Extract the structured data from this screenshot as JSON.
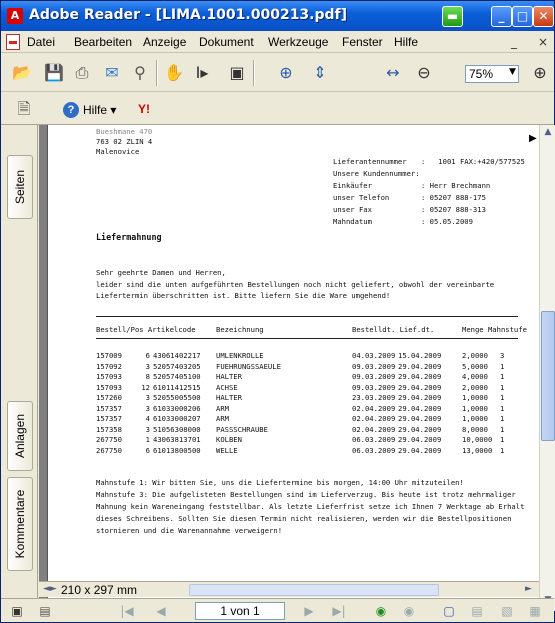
{
  "window": {
    "title": "Adobe Reader - [LIMA.1001.000213.pdf]",
    "app_icon": "adobe-reader-icon",
    "controls": [
      "minimize-icon",
      "maximize-icon",
      "close-icon"
    ]
  },
  "menu": {
    "items": [
      "Datei",
      "Bearbeiten",
      "Anzeige",
      "Dokument",
      "Werkzeuge",
      "Fenster",
      "Hilfe"
    ],
    "mdi_controls": [
      "_",
      "×"
    ]
  },
  "toolbar": {
    "zoom": "75%",
    "icons": [
      "open-icon",
      "save-icon",
      "print-icon",
      "email-icon",
      "search-icon",
      "hand-tool-icon",
      "select-text-icon",
      "snapshot-icon",
      "zoom-in-tool-icon",
      "fit-page-icon",
      "fit-width-icon",
      "zoom-out-icon",
      "zoom-in-icon"
    ]
  },
  "toolbar2": {
    "help_label": "Hilfe",
    "yahoo_label": "Y!"
  },
  "sidebar": {
    "tabs": [
      "Seiten",
      "Anlagen",
      "Kommentare"
    ]
  },
  "document": {
    "address": [
      "763 02 ZLIN 4",
      "Malenovice"
    ],
    "info": [
      {
        "label": "Lieferantennummer",
        "value": ":   1001 FAX:+420/577525"
      },
      {
        "label": "Unsere Kundennummer:",
        "value": ""
      },
      {
        "label": "Einkäufer",
        "value": ": Herr Brechmann"
      },
      {
        "label": "unser Telefon",
        "value": ": 05207 888-175"
      },
      {
        "label": "unser Fax",
        "value": ": 05207 888-313"
      },
      {
        "label": "Mahndatum",
        "value": ": 05.05.2009"
      }
    ],
    "heading": "Liefermahnung",
    "greeting": "Sehr geehrte Damen und Herren,",
    "intro": [
      "leider sind die unten aufgeführten Bestellungen noch nicht geliefert, obwohl der vereinbarte",
      "Liefertermin überschritten ist. Bitte liefern Sie die Ware umgehend!"
    ],
    "columns": [
      "Bestell/Pos Artikelcode",
      "Bezeichnung",
      "Bestelldt. Lief.dt.",
      "Menge Mahnstufe"
    ],
    "rows": [
      {
        "order": "157009",
        "pos": "6",
        "code": "43061402217",
        "name": "UMLENKROLLE",
        "ordered": "04.03.2009",
        "delivery": "15.04.2009",
        "qty": "2,0000",
        "level": "3"
      },
      {
        "order": "157092",
        "pos": "3",
        "code": "52057403205",
        "name": "FUEHRUNGSSAEULE",
        "ordered": "09.03.2009",
        "delivery": "29.04.2009",
        "qty": "5,0000",
        "level": "1"
      },
      {
        "order": "157093",
        "pos": "8",
        "code": "52057405100",
        "name": "HALTER",
        "ordered": "09.03.2009",
        "delivery": "29.04.2009",
        "qty": "4,0000",
        "level": "1"
      },
      {
        "order": "157093",
        "pos": "12",
        "code": "61011412515",
        "name": "ACHSE",
        "ordered": "09.03.2009",
        "delivery": "29.04.2009",
        "qty": "2,0000",
        "level": "1"
      },
      {
        "order": "157260",
        "pos": "3",
        "code": "52055005500",
        "name": "HALTER",
        "ordered": "23.03.2009",
        "delivery": "29.04.2009",
        "qty": "1,0000",
        "level": "1"
      },
      {
        "order": "157357",
        "pos": "3",
        "code": "61033000206",
        "name": "ARM",
        "ordered": "02.04.2009",
        "delivery": "29.04.2009",
        "qty": "1,0000",
        "level": "1"
      },
      {
        "order": "157357",
        "pos": "4",
        "code": "61033000207",
        "name": "ARM",
        "ordered": "02.04.2009",
        "delivery": "29.04.2009",
        "qty": "1,0000",
        "level": "1"
      },
      {
        "order": "157358",
        "pos": "3",
        "code": "51056308000",
        "name": "PASSSCHRAUBE",
        "ordered": "02.04.2009",
        "delivery": "29.04.2009",
        "qty": "8,0000",
        "level": "1"
      },
      {
        "order": "267750",
        "pos": "1",
        "code": "43063813701",
        "name": "KOLBEN",
        "ordered": "06.03.2009",
        "delivery": "29.04.2009",
        "qty": "10,0000",
        "level": "1"
      },
      {
        "order": "267750",
        "pos": "6",
        "code": "61013800500",
        "name": "WELLE",
        "ordered": "06.03.2009",
        "delivery": "29.04.2009",
        "qty": "13,0000",
        "level": "1"
      }
    ],
    "footer": [
      "Mahnstufe 1: Wir bitten Sie, uns die Liefertermine bis morgen, 14:00 Uhr mitzuteilen!",
      "Mahnstufe 3: Die aufgelisteten Bestellungen sind im Lieferverzug. Bis heute ist trotz mehrmaliger",
      "Mahnung kein Wareneingang feststellbar. Als letzte Lieferfrist setze ich Ihnen 7 Werktage ab Erhalt",
      "dieses Schreibens. Sollten Sie diesen Termin nicht realisieren, werden wir die Bestellpositionen",
      "stornieren und die Warenannahme verweigern!"
    ]
  },
  "status": {
    "page_size": "210 x 297 mm"
  },
  "navigation": {
    "page_field": "1 von 1"
  }
}
